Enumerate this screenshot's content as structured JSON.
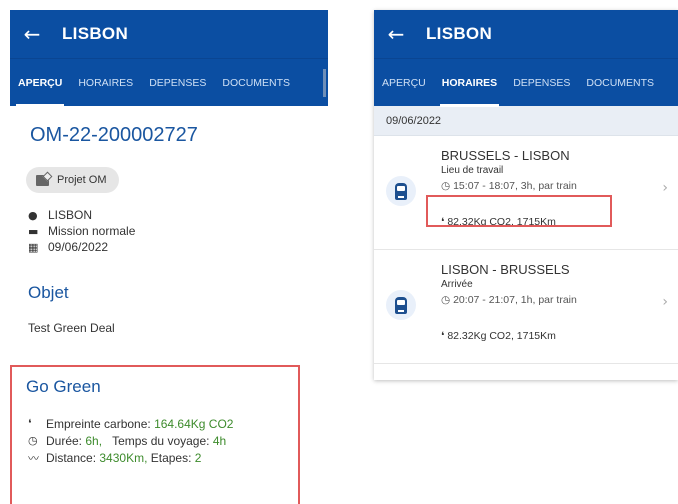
{
  "left": {
    "header": {
      "back_icon": "arrow-left-icon",
      "title": "LISBON"
    },
    "tabs": [
      "APERÇU",
      "HORAIRES",
      "DEPENSES",
      "DOCUMENTS"
    ],
    "active_tab": "APERÇU",
    "om_number": "OM-22-200002727",
    "status_chip": "Projet OM",
    "info": {
      "location": "LISBON",
      "mission_type": "Mission normale",
      "date": "09/06/2022"
    },
    "object_title": "Objet",
    "object_text": "Test Green Deal",
    "go_green": {
      "title": "Go Green",
      "carbon_label": "Empreinte carbone:",
      "carbon_value": "164.64Kg CO2",
      "duration_label": "Durée:",
      "duration_value": "6h,",
      "travel_label": "Temps du voyage:",
      "travel_value": "4h",
      "distance_label": "Distance:",
      "distance_value": "3430Km,",
      "steps_label": "Etapes:",
      "steps_value": "2"
    }
  },
  "right": {
    "header": {
      "back_icon": "arrow-left-icon",
      "title": "LISBON"
    },
    "tabs": [
      "APERÇU",
      "HORAIRES",
      "DEPENSES",
      "DOCUMENTS"
    ],
    "active_tab": "HORAIRES",
    "date": "09/06/2022",
    "trips": [
      {
        "route": "BRUSSELS - LISBON",
        "subtitle": "Lieu de travail",
        "time": "15:07 - 18:07, 3h, par train",
        "co2": "82.32Kg CO2, 1715Km"
      },
      {
        "route": "LISBON - BRUSSELS",
        "subtitle": "Arrivée",
        "time": "20:07 - 21:07, 1h, par train",
        "co2": "82.32Kg CO2, 1715Km"
      }
    ]
  },
  "colors": {
    "header_blue": "#0b4ea2",
    "title_blue": "#1a56a0",
    "green_value": "#3d8b2c",
    "highlight_red": "#e15a5a"
  }
}
